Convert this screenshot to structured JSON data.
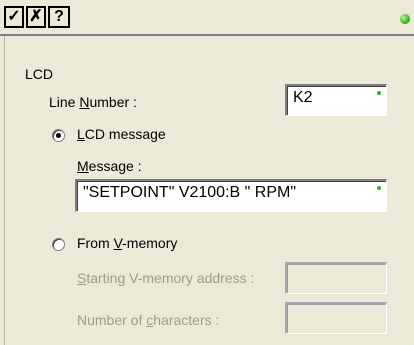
{
  "toolbar": {
    "ok_glyph": "✓",
    "cancel_glyph": "✗",
    "help_glyph": "?"
  },
  "group_title": "LCD",
  "line_number": {
    "label_pre": "Line ",
    "label_u": "N",
    "label_post": "umber :",
    "value": "K2"
  },
  "lcd_message_option": {
    "label_u": "L",
    "label_post": "CD message",
    "selected": true
  },
  "message": {
    "label_u": "M",
    "label_post": "essage :",
    "value": "\"SETPOINT\" V2100:B \" RPM\""
  },
  "vmemory_option": {
    "label_pre": "From ",
    "label_u": "V",
    "label_post": "-memory",
    "selected": false
  },
  "start_address": {
    "label_u": "S",
    "label_post": "tarting V-memory address :",
    "value": ""
  },
  "num_chars": {
    "label_pre": "Number of ",
    "label_u": "c",
    "label_post": "haracters :",
    "value": ""
  },
  "colors": {
    "led": "#3ab51e",
    "valid_dot": "#22bb22",
    "background": "#ece9d8"
  }
}
